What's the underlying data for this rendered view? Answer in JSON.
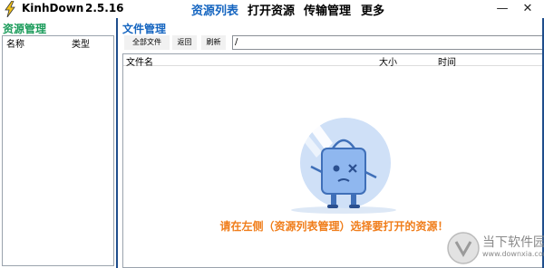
{
  "app": {
    "name": "KinhDown",
    "version": "2.5.16",
    "logo_icon": "lightning-bolt-icon",
    "accent_color": "#1565c0"
  },
  "menu": {
    "items": [
      {
        "label": "资源列表",
        "active": true
      },
      {
        "label": "打开资源",
        "active": false
      },
      {
        "label": "传输管理",
        "active": false
      },
      {
        "label": "更多",
        "active": false
      }
    ]
  },
  "window_controls": {
    "minimize": "—",
    "close": "✕"
  },
  "left_panel": {
    "title": "资源管理",
    "columns": [
      "名称",
      "类型"
    ]
  },
  "right_panel": {
    "title": "文件管理",
    "buttons": {
      "all_files": "全部文件",
      "back": "返回",
      "refresh": "刷新"
    },
    "path_value": "/",
    "columns": {
      "name": "文件名",
      "size": "大小",
      "time": "时间"
    },
    "empty_message": "请在左侧（资源列表管理）选择要打开的资源！",
    "empty_illustration_icon": "confused-bag-mascot-icon"
  },
  "watermark": {
    "text": "当下软件园",
    "url": "www.downxia.com",
    "icon": "downxia-logo-icon"
  }
}
